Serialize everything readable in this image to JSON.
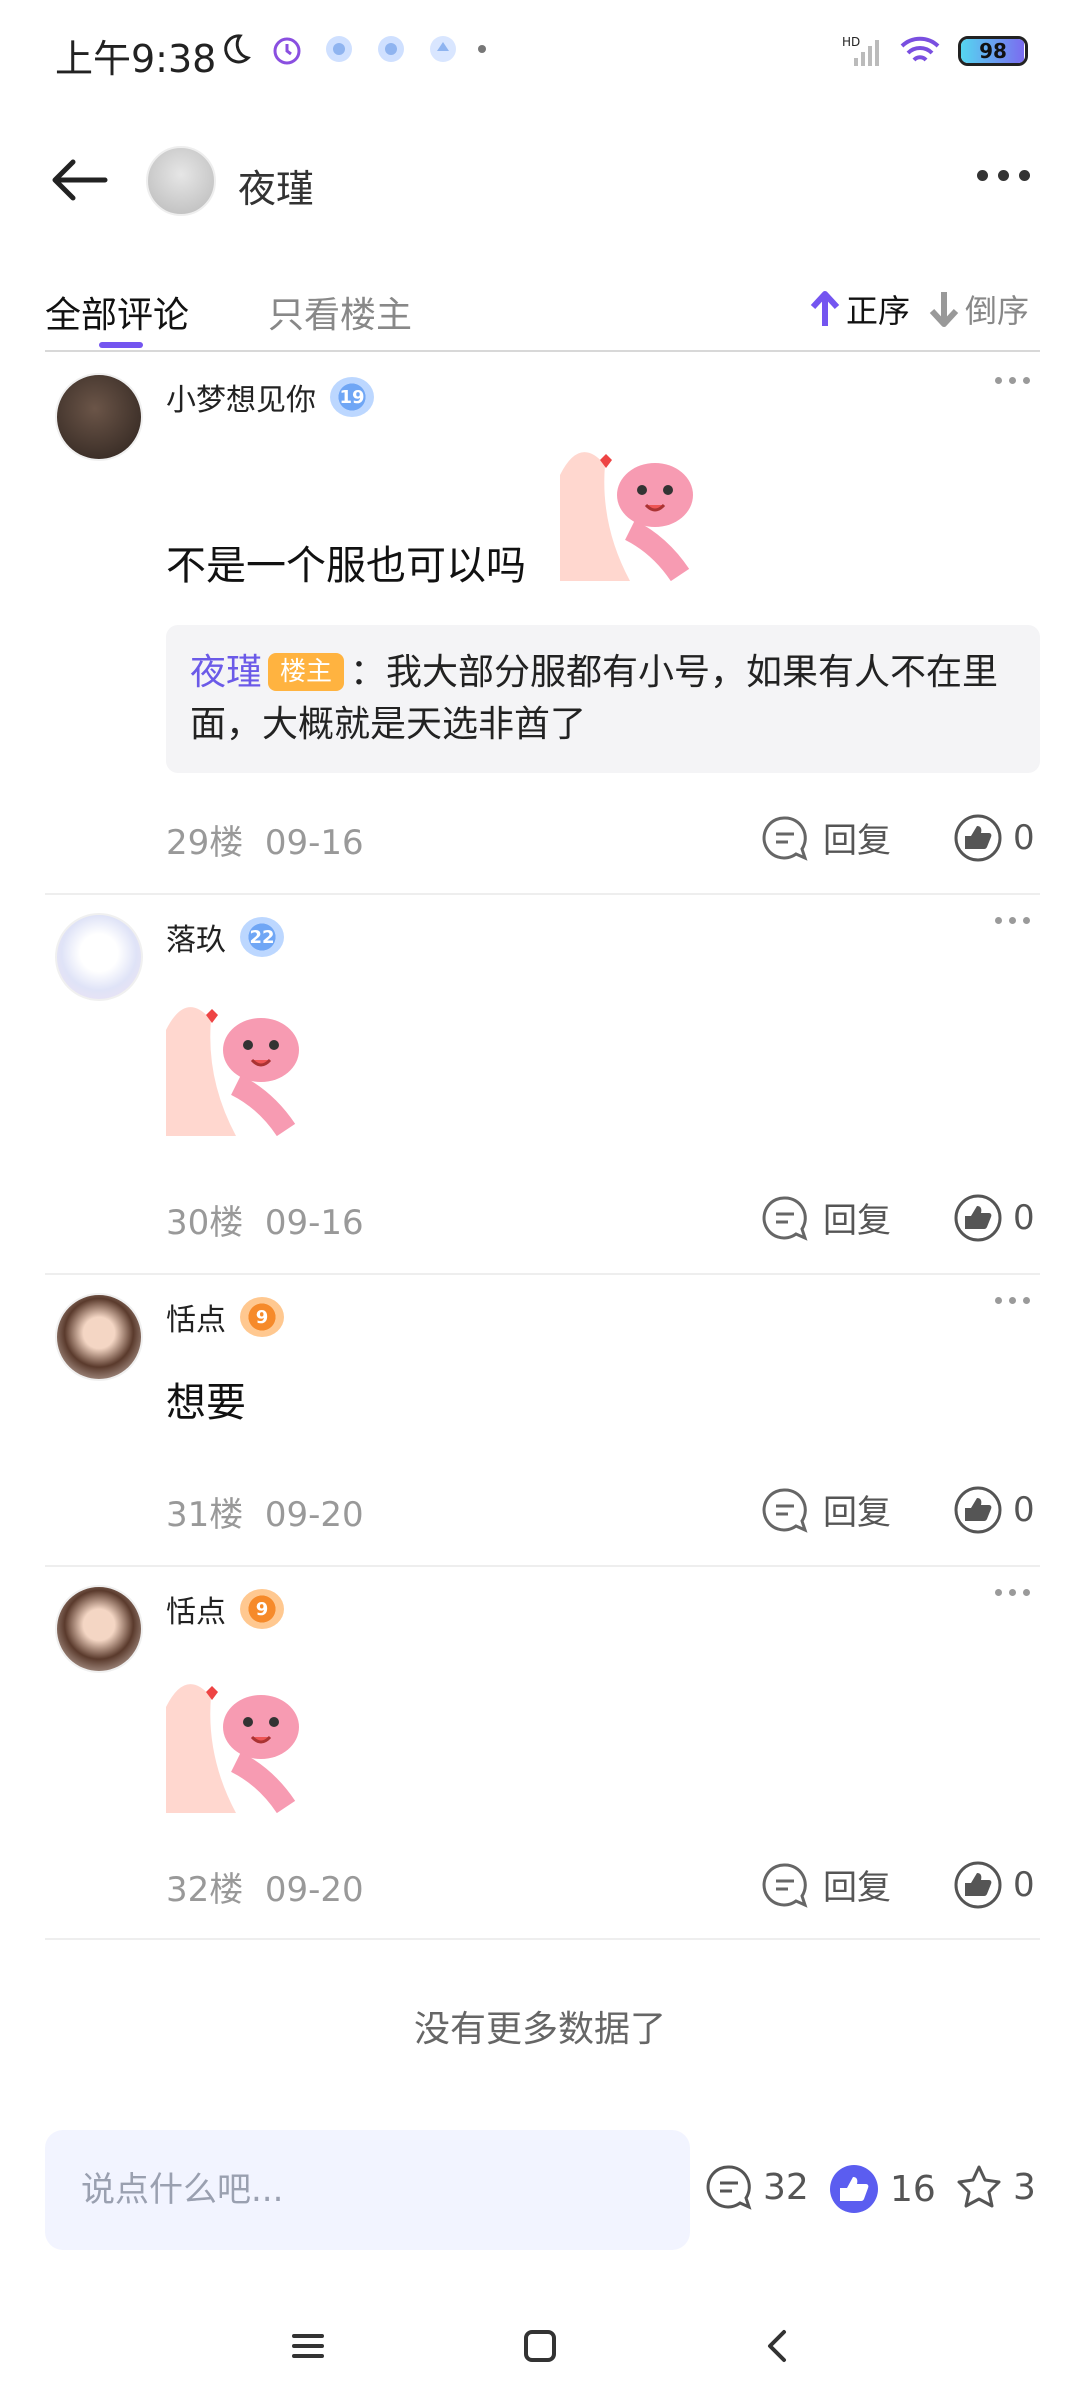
{
  "status_bar": {
    "time": "上午9:38",
    "battery": "98",
    "battery_level": 0.98,
    "signal_label": "HD"
  },
  "header": {
    "title": "夜瑾"
  },
  "tabs": {
    "all": "全部评论",
    "owner_only": "只看楼主"
  },
  "sort": {
    "asc": "正序",
    "desc": "倒序"
  },
  "comments": [
    {
      "username": "小梦想见你",
      "level": "19",
      "text": "不是一个服也可以吗",
      "quote": {
        "name": "夜瑾",
        "tag": "楼主",
        "separator": "：",
        "text": "我大部分服都有小号，如果有人不在里面，大概就是天选非酋了"
      },
      "floor": "29楼",
      "date": "09-16",
      "reply_label": "回复",
      "likes": "0"
    },
    {
      "username": "落玖",
      "level": "22",
      "text": "",
      "floor": "30楼",
      "date": "09-16",
      "reply_label": "回复",
      "likes": "0"
    },
    {
      "username": "恬点",
      "level": "9",
      "text": "想要",
      "floor": "31楼",
      "date": "09-20",
      "reply_label": "回复",
      "likes": "0"
    },
    {
      "username": "恬点",
      "level": "9",
      "text": "",
      "floor": "32楼",
      "date": "09-20",
      "reply_label": "回复",
      "likes": "0"
    }
  ],
  "no_more_text": "没有更多数据了",
  "bottom_bar": {
    "input_placeholder": "说点什么吧...",
    "comment_count": "32",
    "like_count": "16",
    "favorite_count": "3"
  },
  "colors": {
    "accent": "#7455f0",
    "owner_tag": "#ffb340",
    "quote_name": "#6b5ae8"
  },
  "icons": [
    "back-arrow-icon",
    "more-dots-icon",
    "arrow-up-icon",
    "arrow-down-icon",
    "reply-bubble-icon",
    "like-thumb-icon",
    "star-icon",
    "menu-icon",
    "home-square-icon",
    "back-chevron-icon"
  ]
}
